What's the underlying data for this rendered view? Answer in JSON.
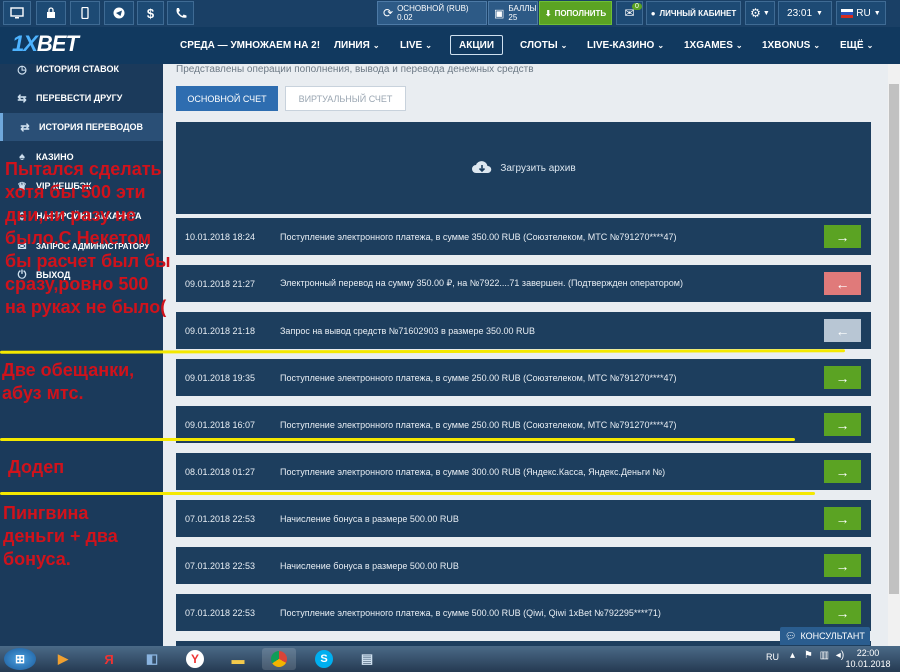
{
  "topbar": {
    "balance_label": "ОСНОВНОЙ (RUB)",
    "balance_value": "0.02",
    "points_label": "БАЛЛЫ",
    "points_value": "25",
    "deposit_label": "ПОПОЛНИТЬ",
    "messages_count": "0",
    "cabinet_label": "ЛИЧНЫЙ КАБИНЕТ",
    "time": "23:01",
    "lang": "RU"
  },
  "nav": {
    "logo_x": "1X",
    "logo_bet": "BET",
    "items": [
      "СРЕДА — УМНОЖАЕМ НА 2!",
      "ЛИНИЯ",
      "LIVE",
      "АКЦИИ",
      "СЛОТЫ",
      "LIVE-КАЗИНО",
      "1XGAMES",
      "1XBONUS",
      "ЕЩЁ"
    ]
  },
  "sidebar": {
    "items": [
      {
        "label": "ИСТОРИЯ СТАВОК"
      },
      {
        "label": "ПЕРЕВЕСТИ ДРУГУ"
      },
      {
        "label": "ИСТОРИЯ ПЕРЕВОДОВ"
      },
      {
        "label": "КАЗИНО"
      },
      {
        "label": "VIP КЕШБЭК"
      },
      {
        "label": "НАСТРОЙКИ АККАУНТА"
      },
      {
        "label": "ЗАПРОС АДМИНИСТРАТОРУ"
      },
      {
        "label": "ВЫХОД"
      }
    ]
  },
  "main": {
    "description": "Представлены операции пополнения, вывода и перевода денежных средств",
    "tab_main": "ОСНОВНОЙ СЧЕТ",
    "tab_virtual": "ВИРТУАЛЬНЫЙ СЧЕТ",
    "archive_label": "Загрузить архив",
    "rows": [
      {
        "date": "10.01.2018 18:24",
        "desc": "Поступление электронного платежа, в сумме 350.00 RUB (Союзтелеком, МТС №791270****47)",
        "btn": "→"
      },
      {
        "date": "09.01.2018 21:27",
        "desc": "Электронный перевод на сумму 350.00 ₽, на №7922....71 завершен. (Подтвержден оператором)",
        "btn": "←"
      },
      {
        "date": "09.01.2018 21:18",
        "desc": "Запрос на вывод средств №71602903 в размере 350.00 RUB",
        "btn": "←"
      },
      {
        "date": "09.01.2018 19:35",
        "desc": "Поступление электронного платежа, в сумме 250.00 RUB (Союзтелеком, МТС №791270****47)",
        "btn": "→"
      },
      {
        "date": "09.01.2018 16:07",
        "desc": "Поступление электронного платежа, в сумме 250.00 RUB (Союзтелеком, МТС №791270****47)",
        "btn": "→"
      },
      {
        "date": "08.01.2018 01:27",
        "desc": "Поступление электронного платежа, в сумме 300.00 RUB (Яндекс.Касса, Яндекс.Деньги №)",
        "btn": "→"
      },
      {
        "date": "07.01.2018 22:53",
        "desc": "Начисление бонуса в размере 500.00 RUB",
        "btn": "→"
      },
      {
        "date": "07.01.2018 22:53",
        "desc": "Начисление бонуса в размере 500.00 RUB",
        "btn": "→"
      },
      {
        "date": "07.01.2018 22:53",
        "desc": "Поступление электронного платежа, в сумме 500.00 RUB (Qiwi, Qiwi 1xBet №792295****71)",
        "btn": "→"
      }
    ]
  },
  "consultant_label": "КОНСУЛЬТАНТ",
  "annotations": {
    "a1": [
      "Пытался сделать",
      "хотя бы 500 эти",
      "дни,ни разу не",
      "было.С Некетом",
      "бы расчет был бы",
      "сразу,ровно 500",
      "на руках не было("
    ],
    "a2": [
      "Две обещанки,",
      "абуз мтс."
    ],
    "a3": "Додеп",
    "a4": [
      "Пингвина",
      "деньги + два",
      "бонуса."
    ]
  },
  "taskbar": {
    "lang": "RU",
    "time": "22:00",
    "date": "10.01.2018"
  },
  "colors": {
    "green": "#5ba323",
    "red": "#e07a7a",
    "grey": "#b8c6d4",
    "annotation": "#d0121b",
    "underline": "#f4e800"
  }
}
